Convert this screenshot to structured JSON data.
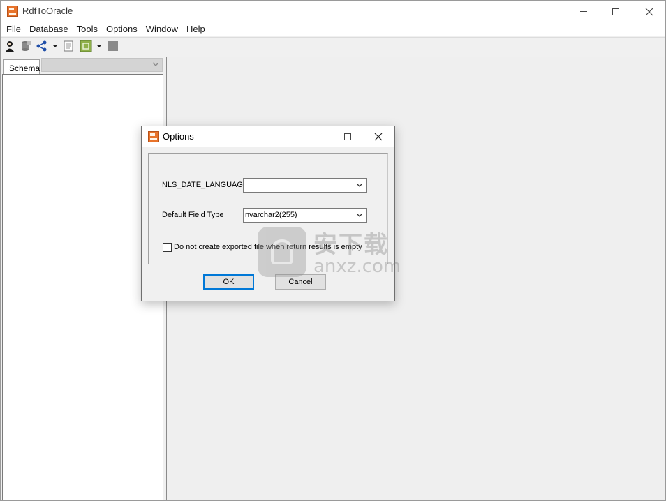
{
  "window": {
    "title": "RdfToOracle",
    "controls": {
      "minimize": "minimize-icon",
      "maximize": "maximize-icon",
      "close": "close-icon"
    }
  },
  "menubar": {
    "items": [
      "File",
      "Database",
      "Tools",
      "Options",
      "Window",
      "Help"
    ]
  },
  "toolbar": {
    "icons": [
      "user-connect-icon",
      "database-icon",
      "share-icon",
      "dropdown-arrow-icon",
      "export-icon",
      "refresh-icon",
      "dropdown-arrow-icon",
      "stop-icon"
    ]
  },
  "left_panel": {
    "tab_label": "Schema",
    "schema_select_value": ""
  },
  "dialog": {
    "title": "Options",
    "fields": [
      {
        "label": "NLS_DATE_LANGUAGE",
        "value": ""
      },
      {
        "label": "Default Field Type",
        "value": "nvarchar2(255)"
      }
    ],
    "checkbox": {
      "label": "Do not create exported file when return results is empty",
      "checked": false
    },
    "ok_label": "OK",
    "cancel_label": "Cancel"
  },
  "watermark": {
    "cn": "安下载",
    "en": "anxz.com"
  },
  "colors": {
    "accent": "#0078d7",
    "app_icon": "#e8732a",
    "workspace": "#efefef"
  }
}
